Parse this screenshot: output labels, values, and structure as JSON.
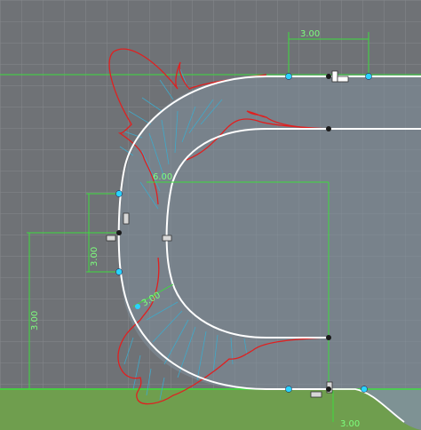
{
  "colors": {
    "background": "#6f7276",
    "grid": "#8a8d91",
    "profile_fill": "#7f909c",
    "ground_fill": "#6f9e4e",
    "curve": "#ffffff",
    "comb": "#e02020",
    "comb_spines": "#3fa9c9",
    "dimension": "#3ddc3d",
    "axis": "#3ddc3d",
    "point_blue": "#29d3ff",
    "point_black": "#1a1a1a"
  },
  "dimensions": {
    "top": "3.00",
    "middle": "6.00",
    "left_inner": "3.00",
    "left_outer": "3.00",
    "diagonal": "3.00",
    "bottom_right": "3.00"
  },
  "icons": {
    "constraint": "constraint-glyph-icon",
    "tangent": "tangent-glyph-icon",
    "horizontal": "horizontal-glyph-icon",
    "vertical": "vertical-glyph-icon"
  }
}
